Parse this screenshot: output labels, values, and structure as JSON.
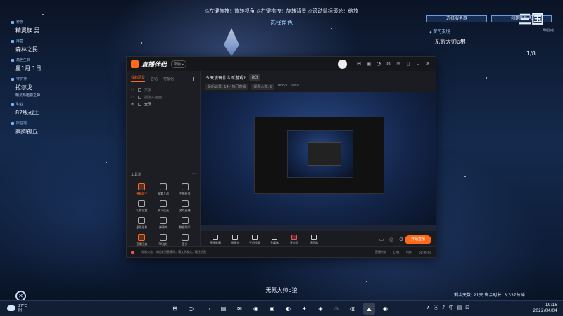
{
  "game": {
    "hotkeys": "◎左键拖拽：旋转视角 ◎右键拖拽：旋转背景 ◎滚动鼠标滚轮：缩放",
    "select_role": "选择角色",
    "left_info": [
      {
        "label": "种族",
        "value": "精灵族 男"
      },
      {
        "label": "阵营",
        "value": "森林之民"
      },
      {
        "label": "角色生日",
        "value": "星1月 1日"
      },
      {
        "label": "守护神",
        "value": "拉尔戈",
        "sub": "精灵与植物之神"
      },
      {
        "label": "职业",
        "value": "82级战士"
      },
      {
        "label": "所在地",
        "value": "高脚孤丘"
      }
    ],
    "right_buttons": [
      "选择服务器",
      "创建新角色"
    ],
    "logo": "三国",
    "logo_sub": "网络游戏",
    "server_label": "梦可支境",
    "character_name": "无氪大帅o狼",
    "page_count": "1/8",
    "bottom_name": "无氪大帅o狼",
    "bottom_stats": "剩余天数: 21天 剩余时长: 3,337分钟"
  },
  "app": {
    "name": "直播伴侣",
    "version_badge": "新版 ▸",
    "scene_tabs": [
      "我的场景",
      "言语",
      "可视化"
    ],
    "sources": [
      {
        "name": "文字",
        "on": false
      },
      {
        "name": "摄像头画面",
        "on": false
      },
      {
        "name": "全屏",
        "on": true
      }
    ],
    "tools_title": "工具箱",
    "tools_more": "···",
    "tools": [
      {
        "name": "弹幕助手",
        "hot": true
      },
      {
        "name": "观看互动",
        "hot": false
      },
      {
        "name": "主播任务",
        "hot": false
      },
      {
        "name": "礼物设置",
        "hot": false
      },
      {
        "name": "多人连麦",
        "hot": false
      },
      {
        "name": "游戏直播",
        "hot": false
      },
      {
        "name": "虚拟形象",
        "hot": false
      },
      {
        "name": "弹幕库",
        "hot": false
      },
      {
        "name": "数据助手",
        "hot": false
      },
      {
        "name": "直播回放",
        "hot": false
      },
      {
        "name": "PK连线",
        "hot": false
      },
      {
        "name": "更多",
        "hot": false
      }
    ],
    "stream_title": "今天该玩什么新游戏?",
    "edit_label": "修改",
    "meta": [
      "最后记录: 14 · 热门直播",
      "观看人数: 0",
      "0kb/s",
      "0/60"
    ],
    "controls": [
      "直播屏幕",
      "摄像头",
      "手机投屏",
      "多媒体",
      "麦克风",
      "扬声器"
    ],
    "start_label": "开始直播",
    "status_text": "礼物公告：欢迎来到直播间，请文明发言，理性消费",
    "status_items": [
      "直播时长",
      "CPU",
      "内存",
      "00:00:00"
    ]
  },
  "taskbar": {
    "weather_temp": "27°C",
    "weather_desc": "阴",
    "apps": [
      "⊞",
      "○",
      "▭",
      "▤",
      "✉",
      "◉",
      "▣",
      "◐",
      "✦",
      "◈",
      "♨",
      "◎",
      "▲",
      "◉"
    ],
    "tray": [
      "∧",
      "⦿",
      "♪",
      "中",
      "▤",
      "⊡"
    ],
    "time": "19:16",
    "date": "2022/04/04"
  }
}
